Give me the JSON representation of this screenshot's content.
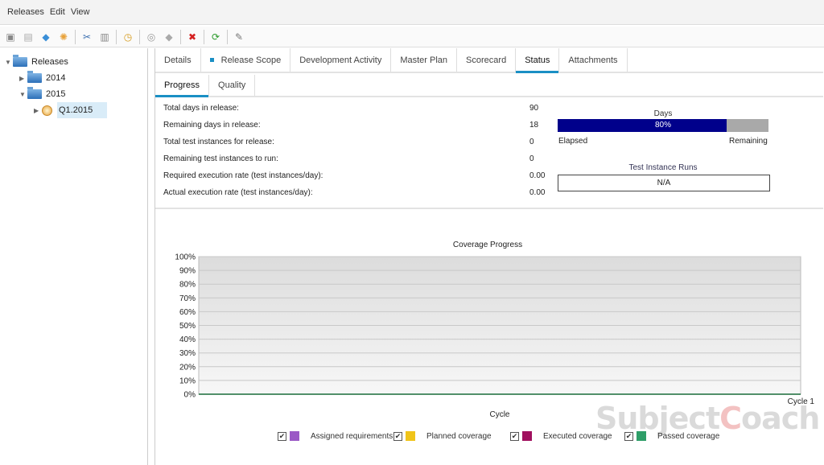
{
  "menu": [
    "Releases",
    "Edit",
    "View"
  ],
  "toolbar": [
    {
      "name": "new-folder-icon",
      "glyph": "▣",
      "color": "#888"
    },
    {
      "name": "new-release-icon",
      "glyph": "▤",
      "color": "#aaa"
    },
    {
      "name": "new-cycle-icon",
      "glyph": "◆",
      "color": "#3a8fd8"
    },
    {
      "name": "rollout-icon",
      "glyph": "✺",
      "color": "#e8a23a"
    },
    {
      "sep": true
    },
    {
      "name": "cut-icon",
      "glyph": "✂",
      "color": "#3b6fb0"
    },
    {
      "name": "paste-icon",
      "glyph": "▥",
      "color": "#888"
    },
    {
      "sep": true
    },
    {
      "name": "clock-icon",
      "glyph": "◷",
      "color": "#d69a1a"
    },
    {
      "sep": true
    },
    {
      "name": "assign-icon",
      "glyph": "◎",
      "color": "#999"
    },
    {
      "name": "diamond-icon",
      "glyph": "◆",
      "color": "#aaa"
    },
    {
      "sep": true
    },
    {
      "name": "delete-icon",
      "glyph": "✖",
      "color": "#d42020"
    },
    {
      "sep": true
    },
    {
      "name": "refresh-icon",
      "glyph": "⟳",
      "color": "#2a9a2a"
    },
    {
      "sep": true
    },
    {
      "name": "edit-icon",
      "glyph": "✎",
      "color": "#777"
    }
  ],
  "tree": {
    "root": "Releases",
    "items": [
      {
        "label": "2014",
        "expanded": false
      },
      {
        "label": "2015",
        "expanded": true,
        "children": [
          {
            "label": "Q1.2015",
            "selected": true
          }
        ]
      }
    ]
  },
  "tabs": [
    {
      "label": "Details",
      "active": false
    },
    {
      "label": "Release Scope",
      "active": false,
      "dot": true
    },
    {
      "label": "Development Activity",
      "active": false
    },
    {
      "label": "Master Plan",
      "active": false
    },
    {
      "label": "Scorecard",
      "active": false
    },
    {
      "label": "Status",
      "active": true
    },
    {
      "label": "Attachments",
      "active": false
    }
  ],
  "subtabs": [
    {
      "label": "Progress",
      "active": true
    },
    {
      "label": "Quality",
      "active": false
    }
  ],
  "stats": [
    {
      "label": "Total days in release:",
      "value": "90"
    },
    {
      "label": "Remaining days in release:",
      "value": "18"
    },
    {
      "label": "Total test instances for release:",
      "value": "0"
    },
    {
      "label": "Remaining test instances to run:",
      "value": "0"
    },
    {
      "label": "Required execution rate (test instances/day):",
      "value": "0.00"
    },
    {
      "label": "Actual execution rate (test instances/day):",
      "value": "0.00"
    }
  ],
  "days": {
    "title": "Days",
    "percent_label": "80%",
    "elapsed_fraction": 0.8,
    "elapsed_label": "Elapsed",
    "remaining_label": "Remaining"
  },
  "test_runs": {
    "title": "Test Instance Runs",
    "value": "N/A"
  },
  "chart_data": {
    "type": "line",
    "title": "Coverage Progress",
    "xlabel": "Cycle",
    "ylabel": "",
    "categories": [
      "Cycle 1"
    ],
    "yticks": [
      "0%",
      "10%",
      "20%",
      "30%",
      "40%",
      "50%",
      "60%",
      "70%",
      "80%",
      "90%",
      "100%"
    ],
    "ylim": [
      0,
      100
    ],
    "grid": true,
    "legend_position": "bottom",
    "series": [
      {
        "name": "Assigned requirements",
        "color": "#9b59c6",
        "checked": true,
        "values": [
          0
        ]
      },
      {
        "name": "Planned coverage",
        "color": "#f0c419",
        "checked": true,
        "values": [
          0
        ]
      },
      {
        "name": "Executed coverage",
        "color": "#a0105e",
        "checked": true,
        "values": [
          0
        ]
      },
      {
        "name": "Passed coverage",
        "color": "#2e9e68",
        "checked": true,
        "values": [
          0
        ]
      }
    ]
  },
  "watermark": {
    "pre": "Subject",
    "c": "C",
    "post": "oach"
  }
}
